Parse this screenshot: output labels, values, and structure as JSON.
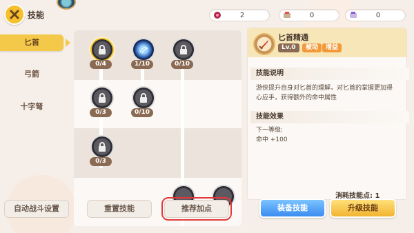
{
  "header": {
    "title": "技能",
    "resources": [
      {
        "icon": "red-gem-icon",
        "value": "2"
      },
      {
        "icon": "skill-book-icon",
        "value": "0"
      },
      {
        "icon": "purple-book-icon",
        "value": "0"
      }
    ]
  },
  "tabs": [
    {
      "label": "匕首",
      "active": true
    },
    {
      "label": "弓箭",
      "active": false
    },
    {
      "label": "十字弩",
      "active": false
    }
  ],
  "tree": {
    "nodes": [
      {
        "level": "0/4",
        "state": "selected",
        "icon": "lock-icon"
      },
      {
        "level": "1/10",
        "state": "unlocked",
        "icon": "blue-swirl-icon"
      },
      {
        "level": "0/10",
        "state": "locked",
        "icon": "lock-icon"
      },
      {
        "level": "0/3",
        "state": "locked",
        "icon": "lock-icon"
      },
      {
        "level": "0/10",
        "state": "locked",
        "icon": "lock-icon"
      },
      {
        "level": "0/3",
        "state": "locked",
        "icon": "lock-icon"
      }
    ]
  },
  "detail": {
    "skill_name": "匕首精通",
    "level_badge": "Lv.0",
    "tags": [
      "被动",
      "增益"
    ],
    "desc_title": "技能说明",
    "desc_text": "游侠提升自身对匕首的理解，对匕首的掌握更加得心应手，获得额外的命中属性",
    "effect_title": "技能效果",
    "next_level_label": "下一等级:",
    "effect_value": "命中  +100",
    "cost_label": "消耗技能点: 1"
  },
  "buttons": {
    "auto_battle": "自动战斗设置",
    "reset": "重置技能",
    "recommend": "推荐加点",
    "equip": "装备技能",
    "upgrade": "升级技能"
  },
  "colors": {
    "accent_gold": "#f4c94a",
    "button_blue": "#3a8cf0",
    "highlight_red": "#e23a3a"
  }
}
